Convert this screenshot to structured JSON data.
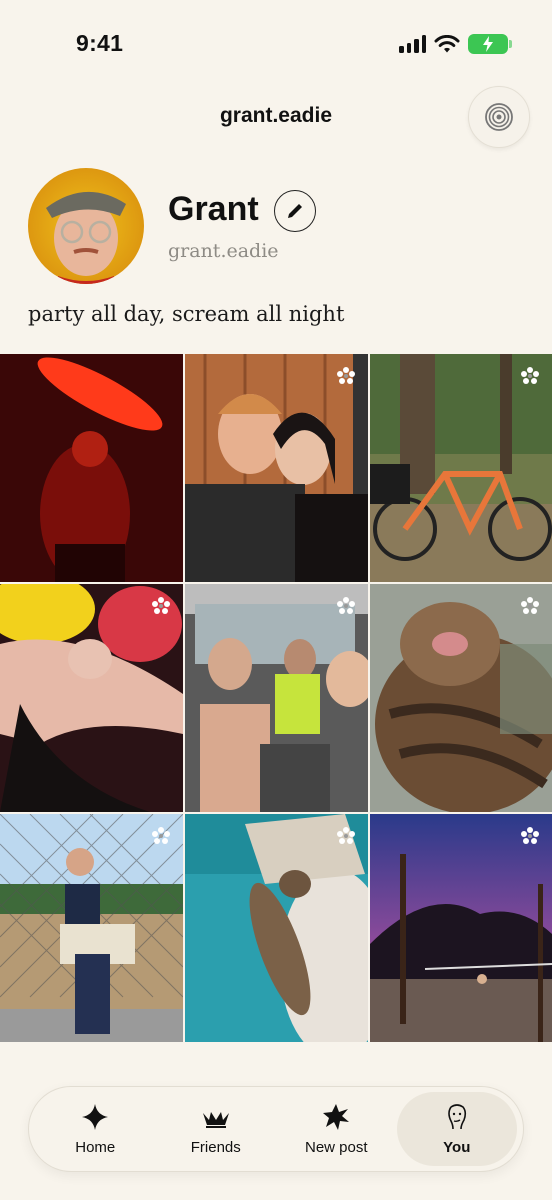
{
  "status_bar": {
    "time": "9:41"
  },
  "header": {
    "handle": "grant.eadie"
  },
  "profile": {
    "display_name": "Grant",
    "username": "grant.eadie",
    "bio": "party all day, scream all night"
  },
  "grid": {
    "photos": [
      {
        "subject": "person in red light",
        "badge": false
      },
      {
        "subject": "couple selfie",
        "badge": true
      },
      {
        "subject": "orange bicycle in forest",
        "badge": true
      },
      {
        "subject": "people hugging at party",
        "badge": true
      },
      {
        "subject": "friends in car",
        "badge": true
      },
      {
        "subject": "cat yawning",
        "badge": true
      },
      {
        "subject": "piggyback at baseball field",
        "badge": true
      },
      {
        "subject": "cat on teal couch",
        "badge": true
      },
      {
        "subject": "beach volleyball at dusk",
        "badge": true
      }
    ]
  },
  "tab_bar": {
    "tabs": [
      {
        "label": "Home",
        "icon": "sparkle-icon"
      },
      {
        "label": "Friends",
        "icon": "friends-icon"
      },
      {
        "label": "New post",
        "icon": "burst-icon"
      },
      {
        "label": "You",
        "icon": "face-icon"
      }
    ],
    "active": "You"
  },
  "colors": {
    "background": "#f8f4ec",
    "battery": "#3cc653",
    "muted_text": "#8e8b85"
  }
}
